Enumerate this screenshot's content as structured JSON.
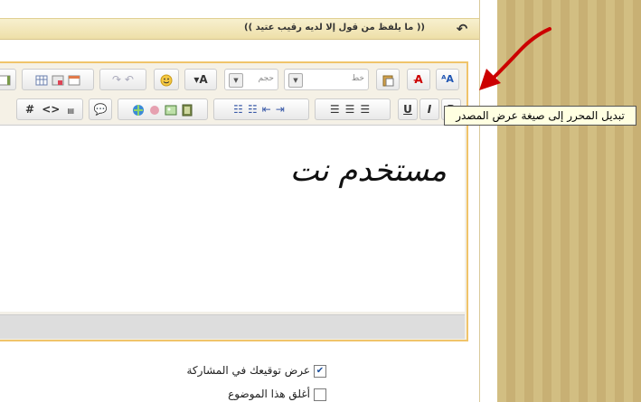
{
  "header": {
    "title": "(( ما يلفظ من قول إلا لديه رقيب عتيد ))",
    "back_icon": "back-arrow-icon"
  },
  "toolbar": {
    "font_select_label": "خط",
    "size_select_label": "حجم",
    "buttons_row1": [
      "source-mode-icon",
      "remove-format-icon",
      "paste-word-icon",
      "text-color-icon",
      "smiley-icon",
      "redo-icon",
      "undo-icon",
      "table-icon",
      "table-insert-icon",
      "table-row-icon",
      "table-col-icon"
    ],
    "buttons_row2": [
      "bold-icon",
      "italic-icon",
      "underline-icon",
      "align-right-icon",
      "align-center-icon",
      "align-left-icon",
      "ordered-list-icon",
      "unordered-list-icon",
      "outdent-icon",
      "indent-icon",
      "link-icon",
      "image-icon",
      "picture-icon",
      "film-icon",
      "quote-icon",
      "hash-icon",
      "code-icon",
      "php-icon"
    ],
    "bold_text": "B",
    "italic_text": "I",
    "underline_text": "U",
    "hash_text": "#",
    "code_text": "<>"
  },
  "editor": {
    "content": "مستخدم نت"
  },
  "tooltip": {
    "text": "تبديل المحرر إلى صيغة عرض المصدر"
  },
  "options": [
    {
      "label": "عرض توقيعك في المشاركة",
      "checked": true
    },
    {
      "label": "أغلق هذا الموضوع",
      "checked": false
    }
  ],
  "colors": {
    "editor_border": "#f0c46a",
    "title_bg": "#eedfa8",
    "stripe_a": "#d2be82",
    "stripe_b": "#c8b074",
    "annotation_arrow": "#cc0000"
  }
}
